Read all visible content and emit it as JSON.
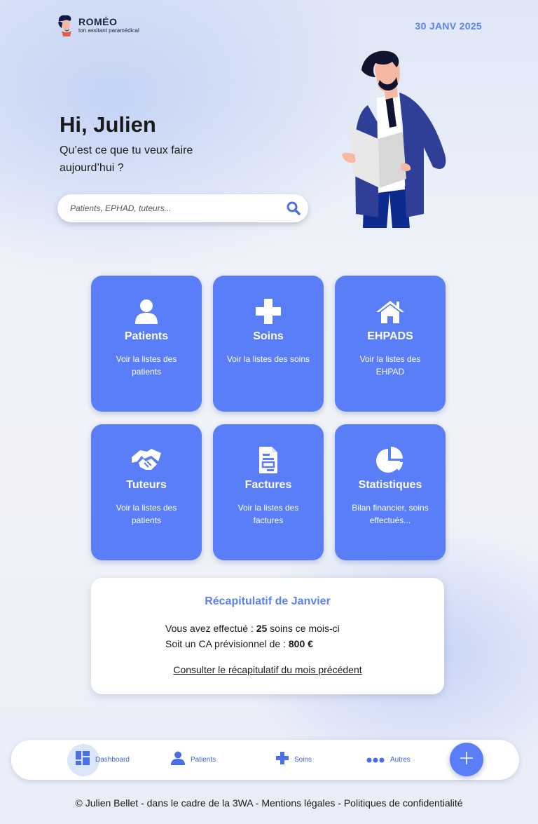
{
  "brand": {
    "name": "ROMÉO",
    "tagline": "ton assitant paramédical"
  },
  "date": "30 JANV 2025",
  "greeting": {
    "title": "Hi, Julien",
    "question": "Qu’est ce que tu veux faire aujourd’hui ?"
  },
  "search": {
    "placeholder": "Patients, EPHAD, tuteurs...",
    "value": "",
    "icon": "search-icon"
  },
  "colors": {
    "accent": "#5a7ef7",
    "accent_text": "#5b82f0",
    "nav_text": "#3d5ec9"
  },
  "cards": [
    {
      "title": "Patients",
      "desc": "Voir la listes des patients",
      "icon": "user-icon"
    },
    {
      "title": "Soins",
      "desc": "Voir la listes des soins",
      "icon": "plus-icon"
    },
    {
      "title": "EHPADS",
      "desc": "Voir la listes des EHPAD",
      "icon": "home-icon"
    },
    {
      "title": "Tuteurs",
      "desc": "Voir la listes des patients",
      "icon": "handshake-icon"
    },
    {
      "title": "Factures",
      "desc": "Voir la listes des factures",
      "icon": "invoice-icon"
    },
    {
      "title": "Statistiques",
      "desc": "Bilan financier, soins effectués...",
      "icon": "pie-chart-icon"
    }
  ],
  "recap": {
    "title": "Récapitulatif de Janvier",
    "line1_prefix": "Vous avez effectué :",
    "soins_count": "25",
    "line1_suffix": "soins ce mois-ci",
    "line2_prefix": "Soit un CA prévisionnel de :",
    "ca_value": "800 €",
    "link": "Consulter le récapitulatif du mois précédent"
  },
  "nav": {
    "items": [
      {
        "label": "Dashboard",
        "icon": "dashboard-icon",
        "active": true
      },
      {
        "label": "Patients",
        "icon": "user-icon"
      },
      {
        "label": "Soins",
        "icon": "plus-icon"
      },
      {
        "label": "Autres",
        "icon": "more-icon"
      }
    ],
    "fab_icon": "add-icon"
  },
  "footer": {
    "copyright": "© Julien Bellet - dans le cadre de la 3WA",
    "legal": "Mentions légales",
    "privacy": "Politiques de confidentialité"
  }
}
